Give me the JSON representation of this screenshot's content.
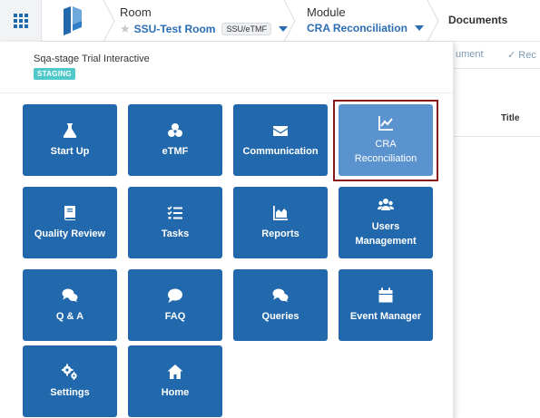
{
  "topbar": {
    "room": {
      "label": "Room",
      "value": "SSU-Test Room",
      "tag": "SSU/eTMF"
    },
    "module": {
      "label": "Module",
      "value": "CRA Reconciliation"
    },
    "documents_label": "Documents"
  },
  "background": {
    "tab1": "ument",
    "tab2": "✓ Rec",
    "title_header": "Title"
  },
  "panel": {
    "org_name": "Sqa-stage Trial Interactive",
    "env_badge": "STAGING",
    "tiles": [
      {
        "label": "Start Up",
        "icon": "flask-icon"
      },
      {
        "label": "eTMF",
        "icon": "biohazard-icon"
      },
      {
        "label": "Communication",
        "icon": "envelope-icon"
      },
      {
        "label": "CRA Reconciliation",
        "icon": "line-chart-icon",
        "active": true
      },
      {
        "label": "Quality Review",
        "icon": "book-icon"
      },
      {
        "label": "Tasks",
        "icon": "tasks-icon"
      },
      {
        "label": "Reports",
        "icon": "area-chart-icon"
      },
      {
        "label": "Users Management",
        "icon": "users-icon"
      },
      {
        "label": "Q & A",
        "icon": "comments-icon"
      },
      {
        "label": "FAQ",
        "icon": "comment-icon"
      },
      {
        "label": "Queries",
        "icon": "comments-icon"
      },
      {
        "label": "Event Manager",
        "icon": "calendar-icon"
      },
      {
        "label": "Settings",
        "icon": "cogs-icon"
      },
      {
        "label": "Home",
        "icon": "home-icon"
      }
    ]
  },
  "colors": {
    "tile": "#2268ac",
    "tile_active": "#5b93cf",
    "highlight_border": "#8a1a1a",
    "link_blue": "#2a6db5",
    "staging_badge": "#4fc9c9"
  }
}
